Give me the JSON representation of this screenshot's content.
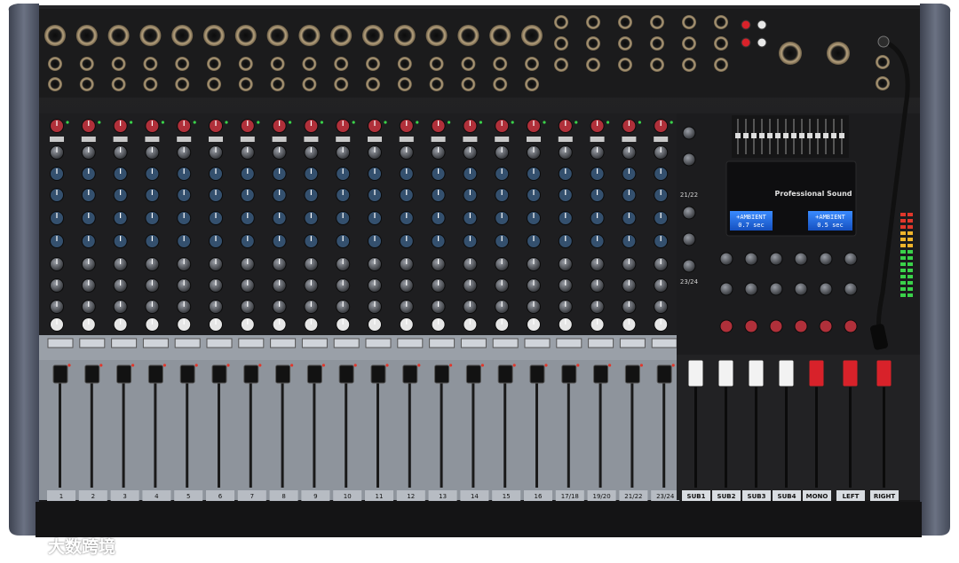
{
  "channels": [
    "1",
    "2",
    "3",
    "4",
    "5",
    "6",
    "7",
    "8",
    "9",
    "10",
    "11",
    "12",
    "13",
    "14",
    "15",
    "16",
    "17/18",
    "19/20",
    "21/22",
    "23/24"
  ],
  "groups": [
    "SUB1",
    "SUB2",
    "SUB3",
    "SUB4",
    "MONO",
    "LEFT",
    "RIGHT"
  ],
  "stereo_return_labels": [
    "21/22",
    "23/24"
  ],
  "display": {
    "brand_text": "Professional Sound",
    "left_screen": {
      "line1": "+AMBIENT",
      "line2": "0.7 sec"
    },
    "right_screen": {
      "line1": "+AMBIENT",
      "line2": "0.5 sec"
    }
  },
  "watermark": {
    "text": "大数跨境",
    "logo_name": "brand-logo"
  },
  "colors": {
    "chassis": "#1c1c1e",
    "end_cheek": "#5d6475",
    "fader_bay": "#8e949c",
    "lcd_blue": "#1f6fe0",
    "fader_red": "#d8222a",
    "fader_white": "#f2f2f2"
  }
}
